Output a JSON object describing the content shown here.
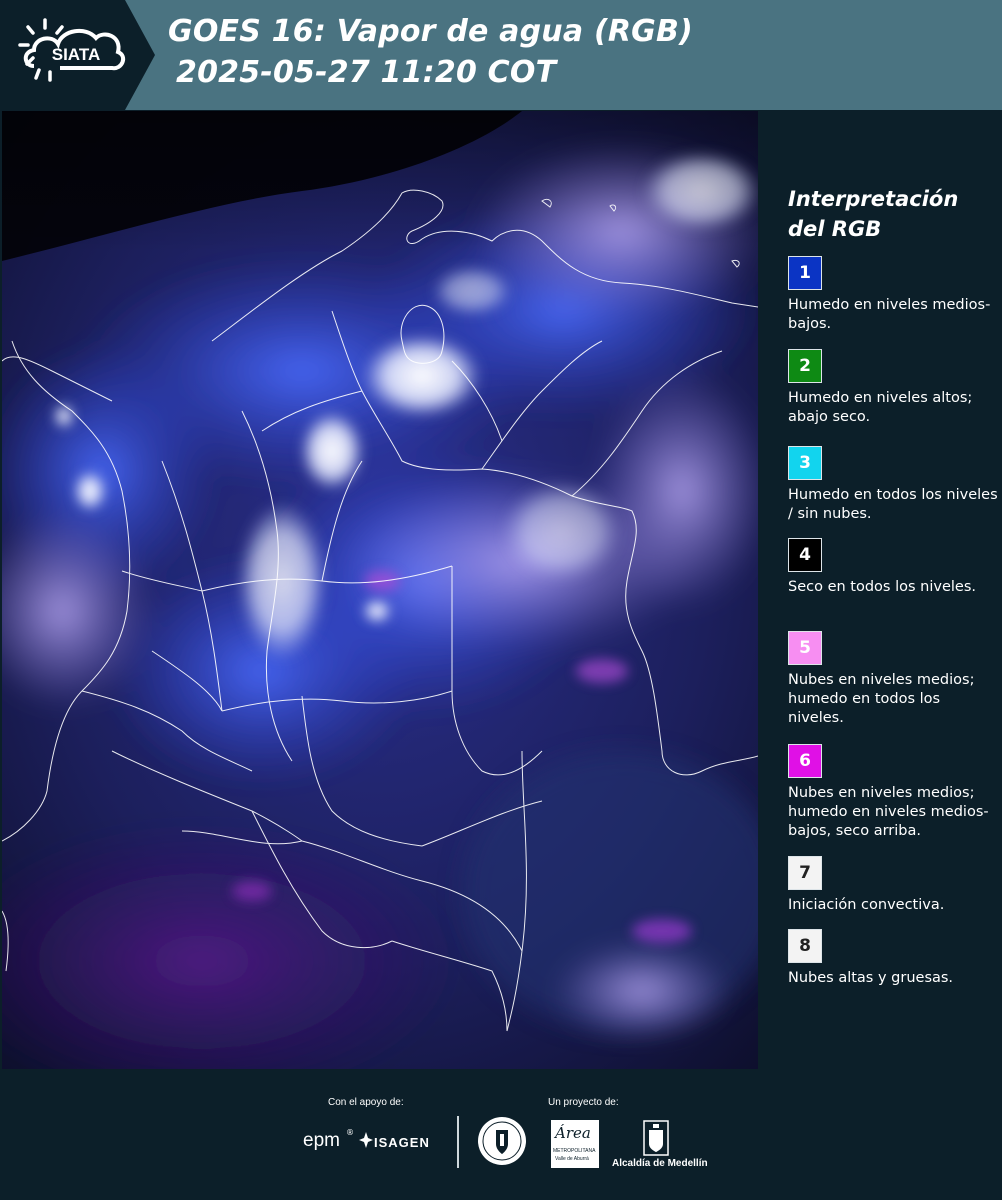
{
  "header": {
    "logo_text": "SIATA",
    "title_line1": "GOES 16: Vapor de agua (RGB)",
    "title_line2": "2025-05-27 11:20 COT"
  },
  "map": {
    "icon": "satellite-rgb-map"
  },
  "legend": {
    "title": "Interpretación del RGB",
    "items": [
      {
        "number": "1",
        "color": "#0b34c4",
        "text": "Humedo en niveles medios-bajos."
      },
      {
        "number": "2",
        "color": "#0e8a14",
        "text": "Humedo en niveles altos; abajo seco."
      },
      {
        "number": "3",
        "color": "#12d4ee",
        "text": "Humedo en todos los niveles / sin nubes."
      },
      {
        "number": "4",
        "color": "#000000",
        "text": "Seco en todos los niveles."
      },
      {
        "number": "5",
        "color": "#f78ef2",
        "text": "Nubes en niveles medios; humedo en todos los niveles."
      },
      {
        "number": "6",
        "color": "#e010e6",
        "text": "Nubes en niveles medios; humedo en niveles medios-bajos, seco arriba."
      },
      {
        "number": "7",
        "color": "#f3f3f3",
        "text": "Iniciación convectiva."
      },
      {
        "number": "8",
        "color": "#f3f3f3",
        "text": "Nubes altas y gruesas."
      }
    ]
  },
  "footer": {
    "support_label": "Con el apoyo de:",
    "project_label": "Un proyecto de:",
    "epm": "epm",
    "isagen": "ISAGEN",
    "area_line1": "Área",
    "area_line2": "METROPOLITANA",
    "area_line3": "Valle de Aburrá",
    "alcaldia": "Alcaldía de Medellín"
  }
}
